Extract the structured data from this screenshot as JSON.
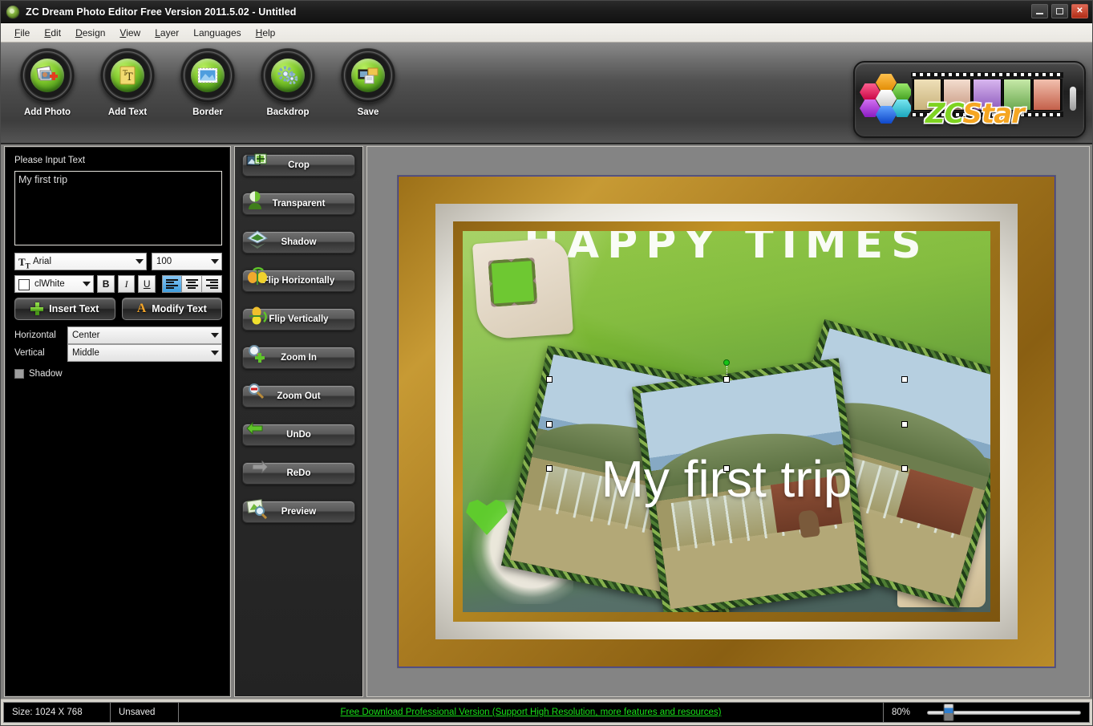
{
  "window": {
    "title": "ZC Dream Photo Editor Free Version 2011.5.02 - Untitled",
    "app_icon": "app-logo-icon",
    "controls": {
      "minimize": "minimize-icon",
      "maximize": "maximize-icon",
      "close": "✕"
    }
  },
  "menubar": {
    "items": [
      {
        "label": "File",
        "accel": "F"
      },
      {
        "label": "Edit",
        "accel": "E"
      },
      {
        "label": "Design",
        "accel": "D"
      },
      {
        "label": "View",
        "accel": "V"
      },
      {
        "label": "Layer",
        "accel": "L"
      },
      {
        "label": "Languages",
        "accel": ""
      },
      {
        "label": "Help",
        "accel": "H"
      }
    ]
  },
  "toolbar": {
    "buttons": [
      {
        "label": "Add Photo",
        "icon": "add-photo-icon"
      },
      {
        "label": "Add Text",
        "icon": "add-text-icon"
      },
      {
        "label": "Border",
        "icon": "border-icon"
      },
      {
        "label": "Backdrop",
        "icon": "backdrop-icon"
      },
      {
        "label": "Save",
        "icon": "save-icon"
      }
    ],
    "logo": {
      "zc": "ZC",
      "star": "Star",
      "icon": "zcstar-logo-icon"
    }
  },
  "text_panel": {
    "prompt": "Please Input Text",
    "text_value": "My first trip",
    "text_placeholder": "",
    "font_family": "Arial",
    "font_size": "100",
    "color_name": "clWhite",
    "color_hex": "#ffffff",
    "bold_label": "B",
    "italic_label": "I",
    "underline_label": "U",
    "align_left_icon": "align-left-icon",
    "align_center_icon": "align-center-icon",
    "align_right_icon": "align-right-icon",
    "active_align": "left",
    "insert_button": "Insert Text",
    "modify_button": "Modify Text",
    "horizontal_label": "Horizontal",
    "horizontal_value": "Center",
    "vertical_label": "Vertical",
    "vertical_value": "Middle",
    "shadow_label": "Shadow",
    "shadow_checked": false
  },
  "tools_panel": {
    "buttons": [
      {
        "label": "Crop",
        "icon": "crop-icon"
      },
      {
        "label": "Transparent",
        "icon": "transparent-icon"
      },
      {
        "label": "Shadow",
        "icon": "shadow-icon"
      },
      {
        "label": "Flip Horizontally",
        "icon": "flip-horizontal-icon"
      },
      {
        "label": "Flip Vertically",
        "icon": "flip-vertical-icon"
      },
      {
        "label": "Zoom In",
        "icon": "zoom-in-icon"
      },
      {
        "label": "Zoom Out",
        "icon": "zoom-out-icon"
      },
      {
        "label": "UnDo",
        "icon": "undo-icon"
      },
      {
        "label": "ReDo",
        "icon": "redo-icon"
      },
      {
        "label": "Preview",
        "icon": "preview-icon"
      }
    ]
  },
  "canvas": {
    "headline": "HAPPY TIMES",
    "overlay_text": "My first trip",
    "selection_handles": 8,
    "rotation_handle": "rotation-handle-icon",
    "frame_color": "#b98c2a",
    "background_color": "#848484"
  },
  "statusbar": {
    "size_label": "Size: 1024 X 768",
    "saved_state": "Unsaved",
    "promo_link": "Free Download Professional Version (Support High Resolution, more features and resources)",
    "promo_color": "#19e019",
    "zoom_percent": "80%",
    "zoom_value": 80
  }
}
